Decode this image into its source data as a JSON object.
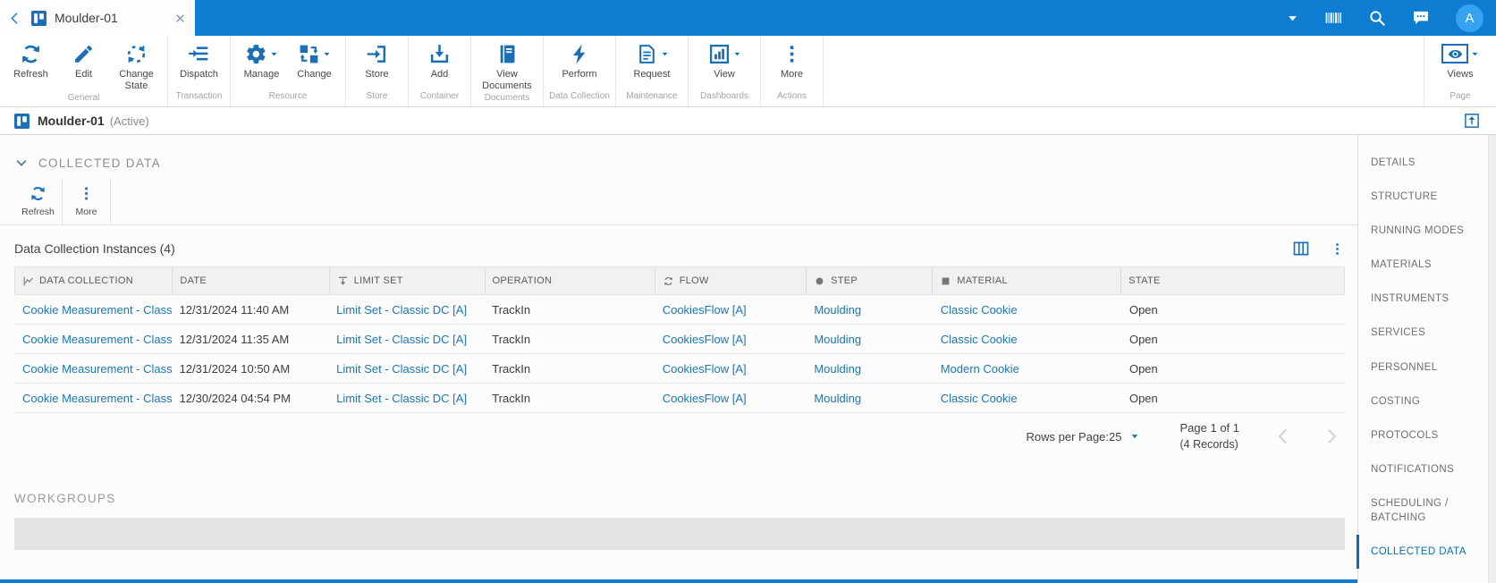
{
  "titlebar": {
    "tab": {
      "title": "Moulder-01"
    },
    "avatar_initial": "A"
  },
  "ribbon": {
    "groups": [
      {
        "label": "General",
        "buttons": [
          {
            "label": "Refresh"
          },
          {
            "label": "Edit"
          },
          {
            "label": "Change State"
          }
        ]
      },
      {
        "label": "Transaction",
        "buttons": [
          {
            "label": "Dispatch"
          }
        ]
      },
      {
        "label": "Resource",
        "buttons": [
          {
            "label": "Manage"
          },
          {
            "label": "Change"
          }
        ]
      },
      {
        "label": "Store",
        "buttons": [
          {
            "label": "Store"
          }
        ]
      },
      {
        "label": "Container",
        "buttons": [
          {
            "label": "Add"
          }
        ]
      },
      {
        "label": "Documents",
        "buttons": [
          {
            "label": "View Documents"
          }
        ]
      },
      {
        "label": "Data Collection",
        "buttons": [
          {
            "label": "Perform"
          }
        ]
      },
      {
        "label": "Maintenance",
        "buttons": [
          {
            "label": "Request"
          }
        ]
      },
      {
        "label": "Dashboards",
        "buttons": [
          {
            "label": "View"
          }
        ]
      },
      {
        "label": "Actions",
        "buttons": [
          {
            "label": "More"
          }
        ]
      },
      {
        "label": "Page",
        "buttons": [
          {
            "label": "Views"
          }
        ]
      }
    ]
  },
  "breadcrumb": {
    "title": "Moulder-01",
    "status": "(Active)"
  },
  "collected_data": {
    "section_title": "COLLECTED DATA",
    "toolbar": [
      {
        "label": "Refresh"
      },
      {
        "label": "More"
      }
    ],
    "table_title": "Data Collection Instances (4)",
    "columns": [
      "DATA COLLECTION",
      "DATE",
      "LIMIT SET",
      "OPERATION",
      "FLOW",
      "STEP",
      "MATERIAL",
      "STATE"
    ],
    "rows": [
      {
        "data_collection": "Cookie Measurement - Classi",
        "date": "12/31/2024 11:40 AM",
        "limit_set": "Limit Set - Classic DC [A]",
        "operation": "TrackIn",
        "flow": "CookiesFlow [A]",
        "step": "Moulding",
        "material": "Classic Cookie",
        "state": "Open"
      },
      {
        "data_collection": "Cookie Measurement - Classi",
        "date": "12/31/2024 11:35 AM",
        "limit_set": "Limit Set - Classic DC [A]",
        "operation": "TrackIn",
        "flow": "CookiesFlow [A]",
        "step": "Moulding",
        "material": "Classic Cookie",
        "state": "Open"
      },
      {
        "data_collection": "Cookie Measurement - Classi",
        "date": "12/31/2024 10:50 AM",
        "limit_set": "Limit Set - Classic DC [A]",
        "operation": "TrackIn",
        "flow": "CookiesFlow [A]",
        "step": "Moulding",
        "material": "Modern Cookie",
        "state": "Open"
      },
      {
        "data_collection": "Cookie Measurement - Classi",
        "date": "12/30/2024 04:54 PM",
        "limit_set": "Limit Set - Classic DC [A]",
        "operation": "TrackIn",
        "flow": "CookiesFlow [A]",
        "step": "Moulding",
        "material": "Classic Cookie",
        "state": "Open"
      }
    ],
    "pagination": {
      "rows_per_page_label": "Rows per Page:",
      "rows_per_page_value": "25",
      "page_info": "Page 1 of 1",
      "records_info": "(4 Records)"
    }
  },
  "workgroups": {
    "section_title": "WORKGROUPS"
  },
  "sidebar": {
    "items": [
      {
        "label": "DETAILS"
      },
      {
        "label": "STRUCTURE"
      },
      {
        "label": "RUNNING MODES"
      },
      {
        "label": "MATERIALS"
      },
      {
        "label": "INSTRUMENTS"
      },
      {
        "label": "SERVICES"
      },
      {
        "label": "PERSONNEL"
      },
      {
        "label": "COSTING"
      },
      {
        "label": "PROTOCOLS"
      },
      {
        "label": "NOTIFICATIONS"
      },
      {
        "label": "SCHEDULING / BATCHING"
      },
      {
        "label": "COLLECTED DATA"
      }
    ]
  },
  "colors": {
    "topbar_blue": "#0d7cd1",
    "icon_blue": "#1d6fb5",
    "link_blue": "#1b77b4",
    "sidebar_active_blue": "#0f6cab",
    "avatar_blue": "#36a3f2"
  }
}
